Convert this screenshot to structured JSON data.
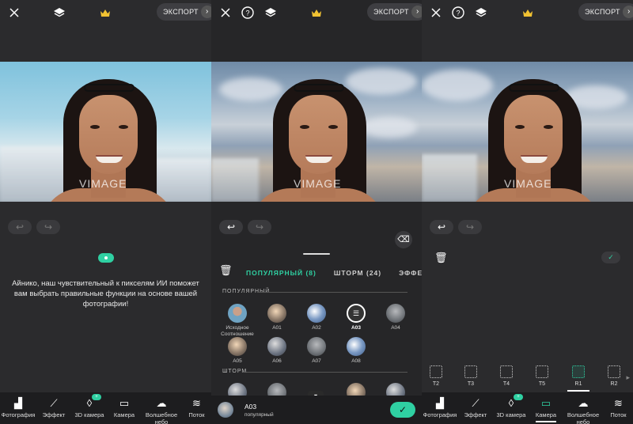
{
  "export_label": "ЭКСПОРТ",
  "watermark": "VIMAGE",
  "ai_message": "Айнико, наш чувствительный к пикселям ИИ поможет вам выбрать правильные функции на основе вашей фотографии!",
  "bottom_nav": [
    {
      "label": "Фотография",
      "icon": "image-icon"
    },
    {
      "label": "Эффект",
      "icon": "magic-wand-icon"
    },
    {
      "label": "3D камера",
      "icon": "3d-camera-icon",
      "badge": "+"
    },
    {
      "label": "Камера",
      "icon": "camera-icon"
    },
    {
      "label": "Волшебное небо",
      "icon": "sky-icon"
    },
    {
      "label": "Поток",
      "icon": "flow-icon"
    }
  ],
  "tabs": [
    "ПОПУЛЯРНЫЙ (8)",
    "ШТОРМ (24)",
    "ЭФФЕКТН"
  ],
  "section_popular": "ПОПУЛЯРНЫЙ",
  "section_storm": "ШТОРМ",
  "filters": [
    {
      "label": "Исходное Соотношение",
      "style": "c-orig"
    },
    {
      "label": "A01",
      "style": "c-b"
    },
    {
      "label": "A02",
      "style": "c-c"
    },
    {
      "label": "A03",
      "style": "c-sel",
      "selected": true
    },
    {
      "label": "A04",
      "style": "c-d"
    },
    {
      "label": "A05",
      "style": "c-b"
    },
    {
      "label": "A06",
      "style": "c-a"
    },
    {
      "label": "A07",
      "style": "c-d"
    },
    {
      "label": "A08",
      "style": "c-c"
    }
  ],
  "selected_filter": {
    "name": "A03",
    "category": "популярный"
  },
  "ratios": [
    "T2",
    "T3",
    "T4",
    "T5",
    "R1",
    "R2"
  ],
  "active_ratio": "R1",
  "accent_color": "#2fd0a2"
}
